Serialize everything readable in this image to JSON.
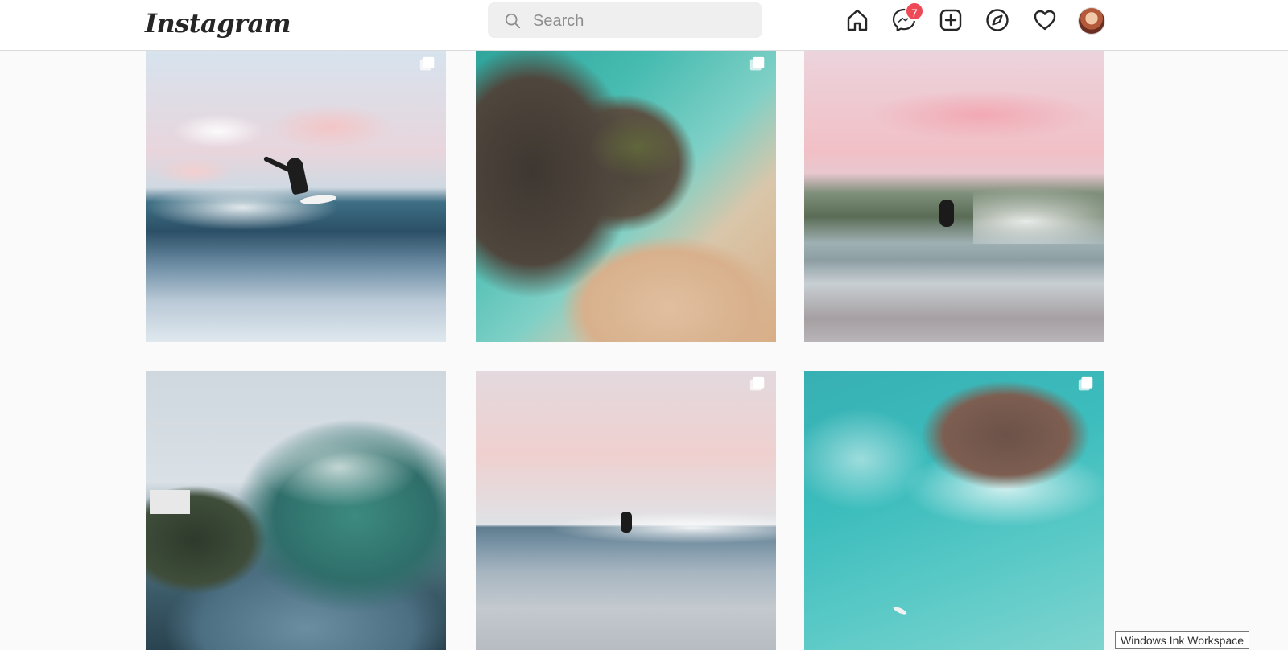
{
  "header": {
    "logo_text": "Instagram",
    "search": {
      "placeholder": "Search",
      "value": ""
    },
    "nav": [
      {
        "name": "home-icon"
      },
      {
        "name": "messenger-icon",
        "badge": "7"
      },
      {
        "name": "new-post-icon"
      },
      {
        "name": "explore-icon"
      },
      {
        "name": "activity-heart-icon"
      },
      {
        "name": "profile-avatar"
      }
    ],
    "badge_color": "#ed4956"
  },
  "grid": {
    "posts": [
      {
        "description": "surfer on wave, pink clouds",
        "multiple": true
      },
      {
        "description": "aerial rocky shore and beach",
        "multiple": true
      },
      {
        "description": "surfer in barrel, pink sky",
        "multiple": false
      },
      {
        "description": "curling turquoise wave",
        "multiple": false
      },
      {
        "description": "surfer on distant wave, pastel sky",
        "multiple": true
      },
      {
        "description": "aerial rocks in turquoise sea",
        "multiple": true
      }
    ]
  },
  "tooltip": {
    "text": "Windows Ink Workspace"
  }
}
